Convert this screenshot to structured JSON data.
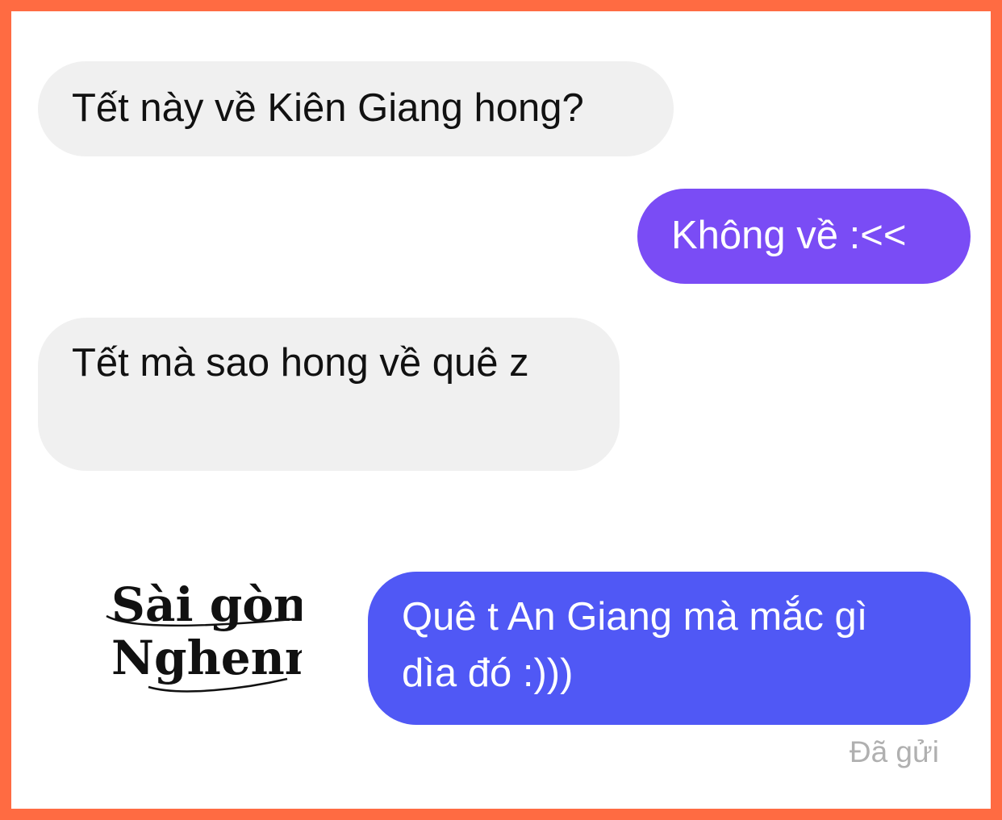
{
  "colors": {
    "border": "#ff6b42",
    "received_bubble": "#f0f0f0",
    "sent_bubble_1": "#7a4cf5",
    "sent_bubble_2": "#5058f5"
  },
  "messages": [
    {
      "direction": "received",
      "text": "Tết này về Kiên Giang hong?"
    },
    {
      "direction": "sent",
      "text": "Không về :<<"
    },
    {
      "direction": "received",
      "text": "Tết mà sao hong về quê z"
    },
    {
      "direction": "sent",
      "lines": [
        "Quê t An Giang mà mắc gì",
        "dìa đó :)))"
      ]
    }
  ],
  "status": "Đã gửi",
  "logo": {
    "line1": "Sài gòn",
    "line2": "Nghenn"
  }
}
